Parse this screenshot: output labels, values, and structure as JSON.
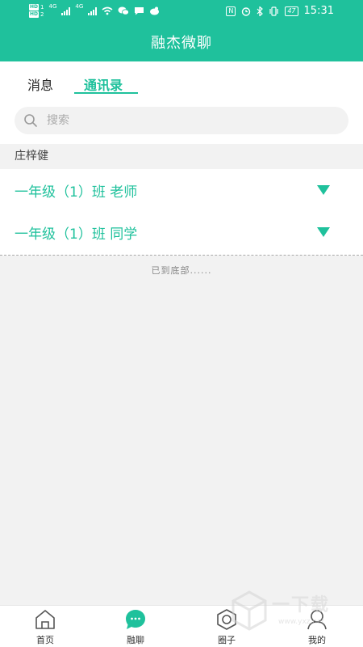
{
  "status_bar": {
    "sim1": "HD",
    "sim1_index": "1",
    "sim2": "HD",
    "sim2_index": "2",
    "net1": "4G",
    "net2": "4G",
    "nfc": "N",
    "battery": "47",
    "time": "15:31"
  },
  "header": {
    "title": "融杰微聊"
  },
  "tabs": [
    {
      "label": "消息",
      "active": false
    },
    {
      "label": "通讯录",
      "active": true
    }
  ],
  "search": {
    "placeholder": "搜索",
    "value": ""
  },
  "contacts": {
    "section_header": "庄梓健",
    "groups": [
      {
        "label": "一年级（1）班 老师"
      },
      {
        "label": "一年级（1）班 同学"
      }
    ],
    "end_note": "已到底部......"
  },
  "bottom_nav": {
    "items": [
      {
        "label": "首页",
        "icon": "home-icon",
        "active": false
      },
      {
        "label": "融聊",
        "icon": "chat-bubble-icon",
        "active": true
      },
      {
        "label": "圈子",
        "icon": "circle-group-icon",
        "active": false
      },
      {
        "label": "我的",
        "icon": "profile-icon",
        "active": false
      }
    ]
  },
  "watermark": {
    "text": "一下载",
    "url": "www.yxz.net"
  },
  "colors": {
    "accent": "#1fc19c",
    "background": "#f2f2f2"
  }
}
